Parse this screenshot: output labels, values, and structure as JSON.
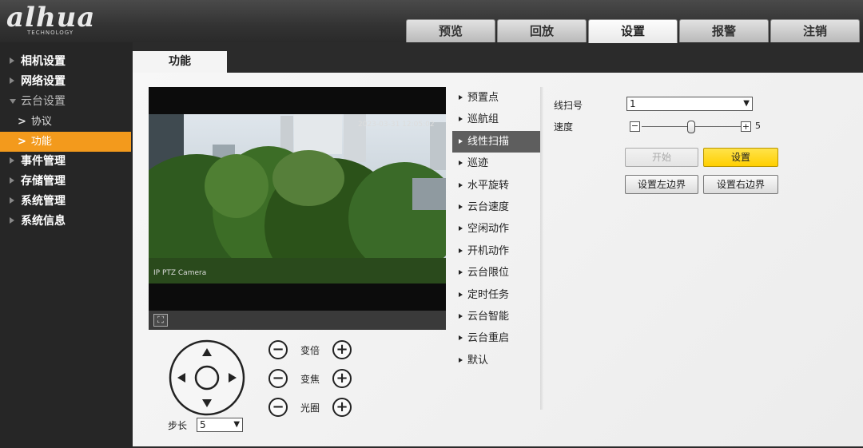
{
  "brand": {
    "name": "alhua",
    "sub": "TECHNOLOGY"
  },
  "top_nav": [
    "预览",
    "回放",
    "设置",
    "报警",
    "注销"
  ],
  "sidebar": {
    "items": [
      {
        "label": "相机设置"
      },
      {
        "label": "网络设置"
      },
      {
        "label": "云台设置",
        "subitems": [
          "协议",
          "功能"
        ]
      },
      {
        "label": "事件管理"
      },
      {
        "label": "存储管理"
      },
      {
        "label": "系统管理"
      },
      {
        "label": "系统信息"
      }
    ]
  },
  "content_tab": "功能",
  "video": {
    "overlay_top": "2023-03-31 12:05:02",
    "overlay_bottom": "IP PTZ Camera"
  },
  "ptz": {
    "zoom_label": "变倍",
    "focus_label": "变焦",
    "iris_label": "光圈",
    "step_label": "步长",
    "step_value": "5"
  },
  "menu": [
    "预置点",
    "巡航组",
    "线性扫描",
    "巡迹",
    "水平旋转",
    "云台速度",
    "空闲动作",
    "开机动作",
    "云台限位",
    "定时任务",
    "云台智能",
    "云台重启",
    "默认"
  ],
  "panel": {
    "scan_no_label": "线扫号",
    "scan_no_value": "1",
    "speed_label": "速度",
    "speed_value": "5",
    "speed_fraction": 0.5,
    "start_btn": "开始",
    "set_btn": "设置",
    "left_btn": "设置左边界",
    "right_btn": "设置右边界"
  },
  "colors": {
    "accent": "#f39a1c",
    "primary_btn": "#ffd700"
  }
}
